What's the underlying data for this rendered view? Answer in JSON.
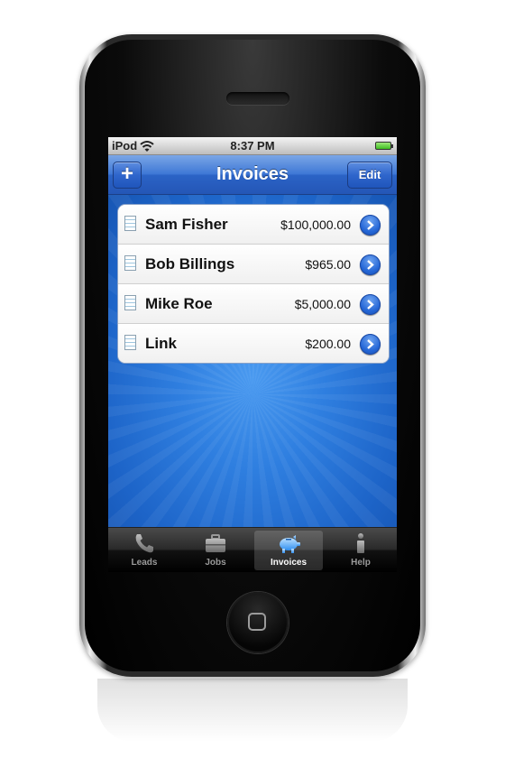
{
  "status_bar": {
    "carrier": "iPod",
    "time": "8:37 PM"
  },
  "nav": {
    "title": "Invoices",
    "add_label": "+",
    "edit_label": "Edit"
  },
  "invoices": [
    {
      "name": "Sam Fisher",
      "amount": "$100,000.00"
    },
    {
      "name": "Bob Billings",
      "amount": "$965.00"
    },
    {
      "name": "Mike Roe",
      "amount": "$5,000.00"
    },
    {
      "name": "Link",
      "amount": "$200.00"
    }
  ],
  "tabs": [
    {
      "label": "Leads",
      "icon": "phone-icon"
    },
    {
      "label": "Jobs",
      "icon": "briefcase-icon"
    },
    {
      "label": "Invoices",
      "icon": "piggy-bank-icon",
      "selected": true
    },
    {
      "label": "Help",
      "icon": "info-icon"
    }
  ],
  "colors": {
    "nav_blue": "#2b63c6",
    "background_blue": "#1d64c8",
    "tab_bar": "#111111"
  }
}
